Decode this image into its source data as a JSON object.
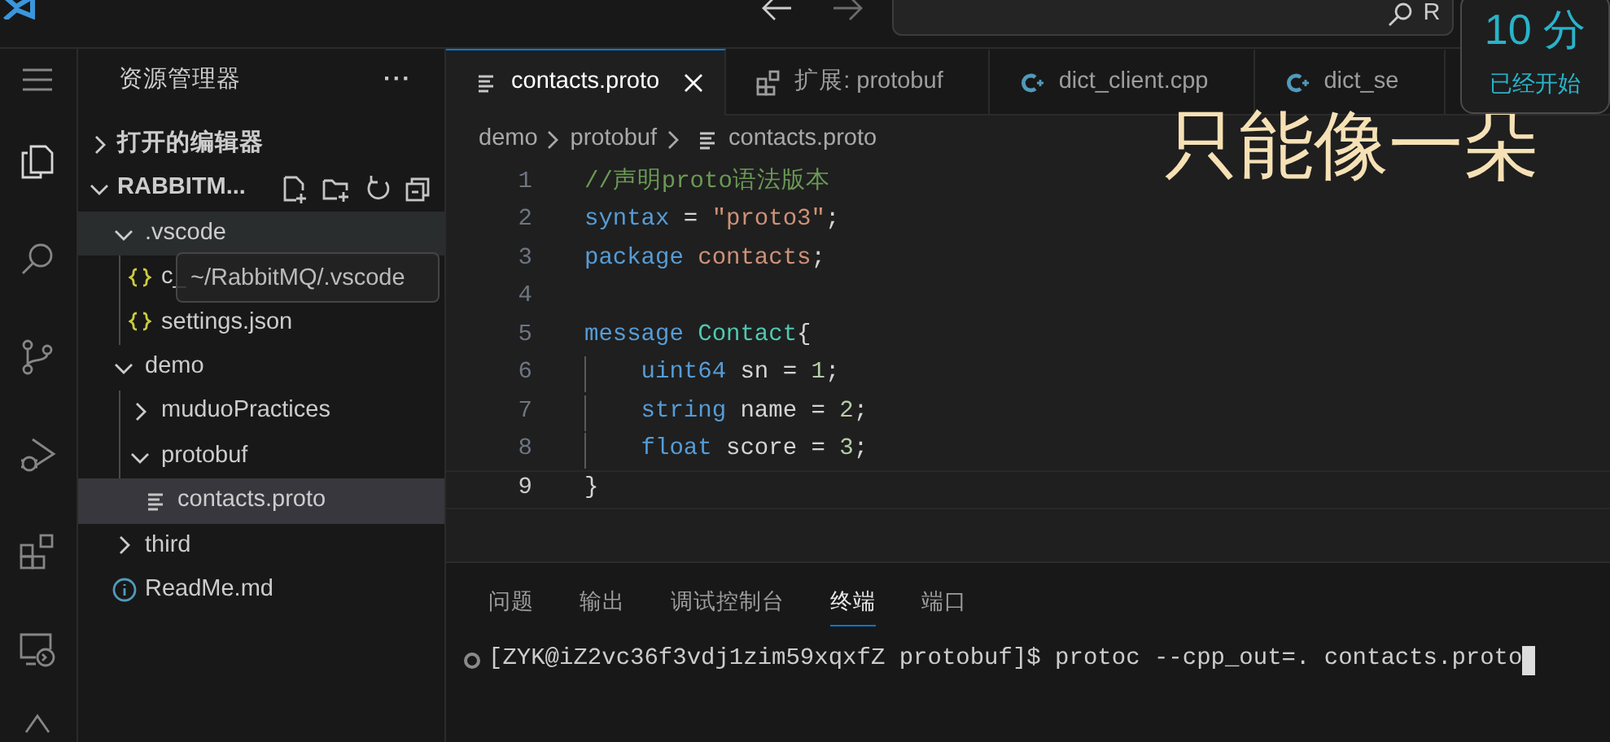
{
  "title_bar": {
    "search_text": "R"
  },
  "timer": {
    "value": "10 分",
    "status": "已经开始"
  },
  "lyric": "只能像一朵",
  "activity_bar": {
    "items": [
      {
        "kind": "menu",
        "selected": false
      },
      {
        "kind": "explorer",
        "selected": true
      },
      {
        "kind": "search",
        "selected": false
      },
      {
        "kind": "source-control",
        "selected": false
      },
      {
        "kind": "run-debug",
        "selected": false
      },
      {
        "kind": "extensions",
        "selected": false
      },
      {
        "kind": "remote",
        "selected": false
      },
      {
        "kind": "more",
        "selected": false
      }
    ]
  },
  "sidebar": {
    "title": "资源管理器",
    "more": "···",
    "sections": [
      {
        "label": "打开的编辑器",
        "expanded": false
      },
      {
        "label": "RABBITM...",
        "expanded": true
      }
    ],
    "tree": [
      {
        "label": ".vscode",
        "kind": "folder",
        "expanded": true,
        "selected": false,
        "hovered": true,
        "children": [
          {
            "label": "c_",
            "kind": "json",
            "selected": false,
            "hovered": false
          },
          {
            "label": "settings.json",
            "kind": "json",
            "selected": false,
            "hovered": false
          }
        ]
      },
      {
        "label": "demo",
        "kind": "folder",
        "expanded": true,
        "selected": false,
        "hovered": false,
        "children": [
          {
            "label": "muduoPractices",
            "kind": "folder",
            "expanded": false,
            "selected": false,
            "hovered": false
          },
          {
            "label": "protobuf",
            "kind": "folder",
            "expanded": true,
            "selected": false,
            "hovered": false,
            "children": [
              {
                "label": "contacts.proto",
                "kind": "proto",
                "selected": true,
                "hovered": false
              }
            ]
          }
        ]
      },
      {
        "label": "third",
        "kind": "folder",
        "expanded": false,
        "selected": false,
        "hovered": false
      },
      {
        "label": "ReadMe.md",
        "kind": "info",
        "selected": false,
        "hovered": false
      }
    ],
    "tooltip": "~/RabbitMQ/.vscode"
  },
  "editor": {
    "tabs": [
      {
        "label": "contacts.proto",
        "kind": "proto",
        "selected": true
      },
      {
        "label": "扩展: protobuf",
        "kind": "extension",
        "selected": false
      },
      {
        "label": "dict_client.cpp",
        "kind": "cpp",
        "selected": false
      },
      {
        "label": "dict_se",
        "kind": "cpp",
        "selected": false
      }
    ],
    "breadcrumb": [
      "demo",
      "protobuf",
      "contacts.proto"
    ],
    "lines": [
      {
        "number": "1",
        "current": false,
        "tokens": [
          {
            "text": "//声明proto语法版本",
            "kind": "comment"
          }
        ]
      },
      {
        "number": "2",
        "current": false,
        "tokens": [
          {
            "text": "syntax",
            "kind": "keyword"
          },
          {
            "text": " = ",
            "kind": "plain"
          },
          {
            "text": "\"proto3\"",
            "kind": "string"
          },
          {
            "text": ";",
            "kind": "plain"
          }
        ]
      },
      {
        "number": "3",
        "current": false,
        "tokens": [
          {
            "text": "package",
            "kind": "keyword"
          },
          {
            "text": " contacts",
            "kind": "string"
          },
          {
            "text": ";",
            "kind": "plain"
          }
        ]
      },
      {
        "number": "4",
        "current": false
      },
      {
        "number": "5",
        "current": false,
        "tokens": [
          {
            "text": "message",
            "kind": "keyword"
          },
          {
            "text": " Contact",
            "kind": "type"
          },
          {
            "text": "{",
            "kind": "plain"
          }
        ]
      },
      {
        "number": "6",
        "current": false,
        "tokens": [
          {
            "text": "    uint64",
            "kind": "keyword"
          },
          {
            "text": " sn = ",
            "kind": "plain"
          },
          {
            "text": "1",
            "kind": "number"
          },
          {
            "text": ";",
            "kind": "plain"
          }
        ]
      },
      {
        "number": "7",
        "current": false,
        "tokens": [
          {
            "text": "    string",
            "kind": "keyword"
          },
          {
            "text": " name = ",
            "kind": "plain"
          },
          {
            "text": "2",
            "kind": "number"
          },
          {
            "text": ";",
            "kind": "plain"
          }
        ]
      },
      {
        "number": "8",
        "current": false,
        "tokens": [
          {
            "text": "    float",
            "kind": "keyword"
          },
          {
            "text": " score = ",
            "kind": "plain"
          },
          {
            "text": "3",
            "kind": "number"
          },
          {
            "text": ";",
            "kind": "plain"
          }
        ]
      },
      {
        "number": "9",
        "current": true,
        "tokens": [
          {
            "text": "}",
            "kind": "plain"
          }
        ]
      }
    ]
  },
  "panel": {
    "tabs": [
      {
        "label": "问题",
        "selected": false
      },
      {
        "label": "输出",
        "selected": false
      },
      {
        "label": "调试控制台",
        "selected": false
      },
      {
        "label": "终端",
        "selected": true
      },
      {
        "label": "端口",
        "selected": false
      }
    ],
    "terminal_line": "[ZYK@iZ2vc36f3vdj1zim59xqxfZ protobuf]$ protoc --cpp_out=. contacts.proto"
  }
}
